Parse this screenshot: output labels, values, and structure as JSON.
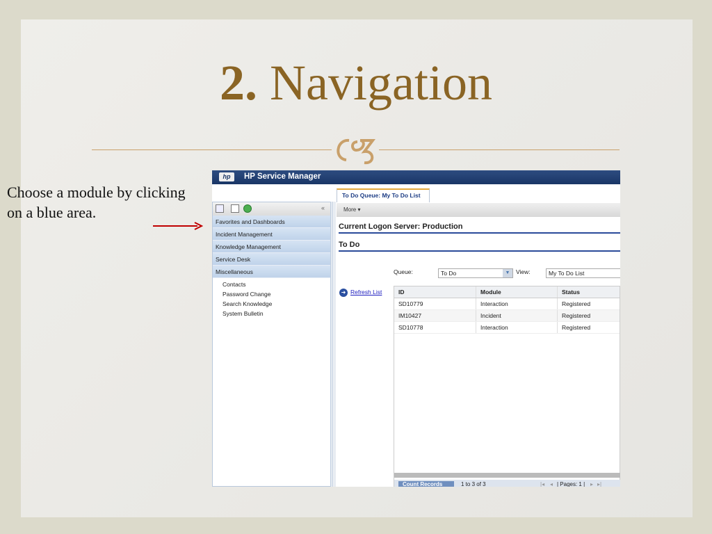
{
  "slide": {
    "title_number": "2.",
    "title_text": "Navigation",
    "caption": "Choose a module by clicking on a blue area."
  },
  "app": {
    "logo": "hp",
    "title": "HP Service Manager",
    "collapse": "«",
    "modules": [
      "Favorites and Dashboards",
      "Incident Management",
      "Knowledge Management",
      "Service Desk",
      "Miscellaneous"
    ],
    "sub_items": [
      "Contacts",
      "Password Change",
      "Search Knowledge",
      "System Bulletin"
    ],
    "tab": "To Do Queue: My To Do List",
    "more": "More ▾",
    "server": "Current Logon Server: Production",
    "section": "To Do",
    "queue_label": "Queue:",
    "queue_value": "To Do",
    "view_label": "View:",
    "view_value": "My To Do List",
    "refresh": "Refresh List",
    "columns": [
      "ID",
      "Module",
      "Status"
    ],
    "rows": [
      [
        "SD10779",
        "Interaction",
        "Registered"
      ],
      [
        "IM10427",
        "Incident",
        "Registered"
      ],
      [
        "SD10778",
        "Interaction",
        "Registered"
      ]
    ],
    "count_records": "Count Records",
    "range": "1 to 3 of 3",
    "pages": "| Pages: 1 |",
    "pager_first": "|◂",
    "pager_prev": "◂",
    "pager_next": "▸",
    "pager_last": "▸|"
  },
  "colors": {
    "title": "#8a6424",
    "header": "#1a3666",
    "module": "#c8d9ee",
    "arrow": "#c00000"
  }
}
